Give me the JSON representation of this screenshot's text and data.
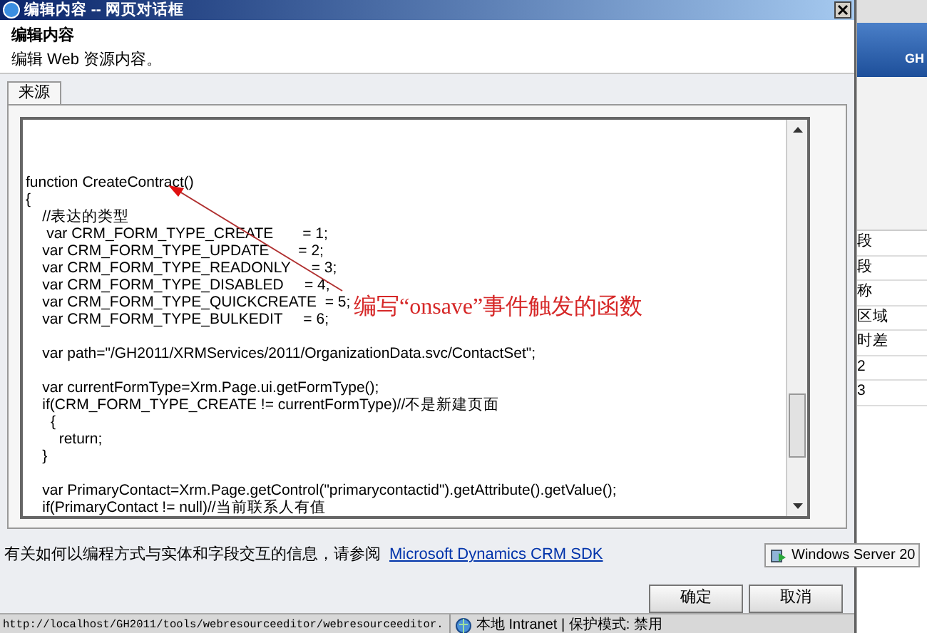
{
  "window": {
    "title": "编辑内容 -- 网页对话框"
  },
  "header": {
    "title": "编辑内容",
    "subtitle": "编辑 Web 资源内容。"
  },
  "tabs": [
    {
      "label": "来源",
      "selected": true
    }
  ],
  "code_lines": [
    {
      "kind": "blank"
    },
    {
      "kind": "blank"
    },
    {
      "kind": "blank"
    },
    {
      "kind": "line",
      "text": "function CreateContract()"
    },
    {
      "kind": "line",
      "text": "{"
    },
    {
      "kind": "line",
      "text": "    //表达的类型"
    },
    {
      "kind": "line",
      "text": "     var CRM_FORM_TYPE_CREATE       = 1;"
    },
    {
      "kind": "line",
      "text": "    var CRM_FORM_TYPE_UPDATE       = 2;"
    },
    {
      "kind": "line",
      "text": "    var CRM_FORM_TYPE_READONLY     = 3;"
    },
    {
      "kind": "line",
      "text": "    var CRM_FORM_TYPE_DISABLED     = 4;"
    },
    {
      "kind": "line",
      "text": "    var CRM_FORM_TYPE_QUICKCREATE  = 5;"
    },
    {
      "kind": "line",
      "text": "    var CRM_FORM_TYPE_BULKEDIT     = 6;"
    },
    {
      "kind": "blank"
    },
    {
      "kind": "line",
      "text": "    var path=\"/GH2011/XRMServices/2011/OrganizationData.svc/ContactSet\";"
    },
    {
      "kind": "blank"
    },
    {
      "kind": "line",
      "text": "    var currentFormType=Xrm.Page.ui.getFormType();"
    },
    {
      "kind": "line",
      "text": "    if(CRM_FORM_TYPE_CREATE != currentFormType)//不是新建页面"
    },
    {
      "kind": "line",
      "text": "      {"
    },
    {
      "kind": "line",
      "text": "        return;"
    },
    {
      "kind": "line",
      "text": "    }"
    },
    {
      "kind": "blank"
    },
    {
      "kind": "line",
      "text": "    var PrimaryContact=Xrm.Page.getControl(\"primarycontactid\").getAttribute().getValue();"
    },
    {
      "kind": "line",
      "text": "    if(PrimaryContact != null)//当前联系人有值"
    }
  ],
  "annotation": {
    "text": "编写“onsave”事件触发的函数"
  },
  "help": {
    "text": "有关如何以编程方式与实体和字段交互的信息，请参阅",
    "link": "Microsoft Dynamics CRM SDK"
  },
  "buttons": [
    "确定",
    "取消"
  ],
  "status_bar": {
    "url": "http://localhost/GH2011/tools/webresourceeditor/webresourceeditor.",
    "zone": "本地 Intranet | 保护模式: 禁用"
  },
  "background_page": {
    "banner": "GH",
    "fragments": [
      "段",
      "段",
      "称",
      "区域",
      "时差",
      "2",
      "3"
    ]
  },
  "tooltip": {
    "text": "Windows Server 20"
  }
}
